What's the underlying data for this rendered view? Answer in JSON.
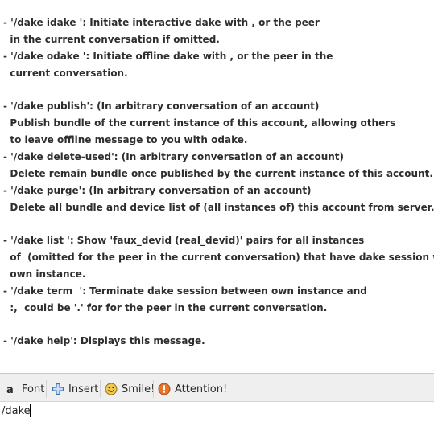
{
  "conversation": {
    "lines": [
      "- '/dake idake ': Initiate interactive dake with , or the peer",
      "  in the current conversation if omitted.",
      "- '/dake odake ': Initiate offline dake with , or the peer in the",
      "  current conversation.",
      "- '/dake publish': (In arbitrary conversation of an account)",
      "  Publish bundle of the current instance of this account, allowing others",
      "  to leave offline message to you with odake.",
      "- '/dake delete-used': (In arbitrary conversation of an account)",
      "  Delete remain bundle once published by the current instance of this account.",
      "- '/dake purge': (In arbitrary conversation of an account)",
      "  Delete all bundle and device list of (all instances of) this account from server.",
      "- '/dake list ': Show 'faux_devid (real_devid)' pairs for all instances",
      "  of  (omitted for the peer in the current conversation) that have dake session with",
      "  own instance.",
      "- '/dake term  ': Terminate dake session between own instance and",
      "  :,  could be '.' for for the peer in the current conversation.",
      "- '/dake help': Displays this message."
    ]
  },
  "toolbar": {
    "font_label": "Font",
    "insert_label": "Insert",
    "smile_label": "Smile!",
    "attention_label": "Attention!"
  },
  "input": {
    "value": "/dake"
  },
  "colors": {
    "attention_icon": "#e8742a",
    "smile_icon": "#f2c94c",
    "insert_icon": "#3b73b9",
    "toolbar_bg": "#efefef"
  }
}
